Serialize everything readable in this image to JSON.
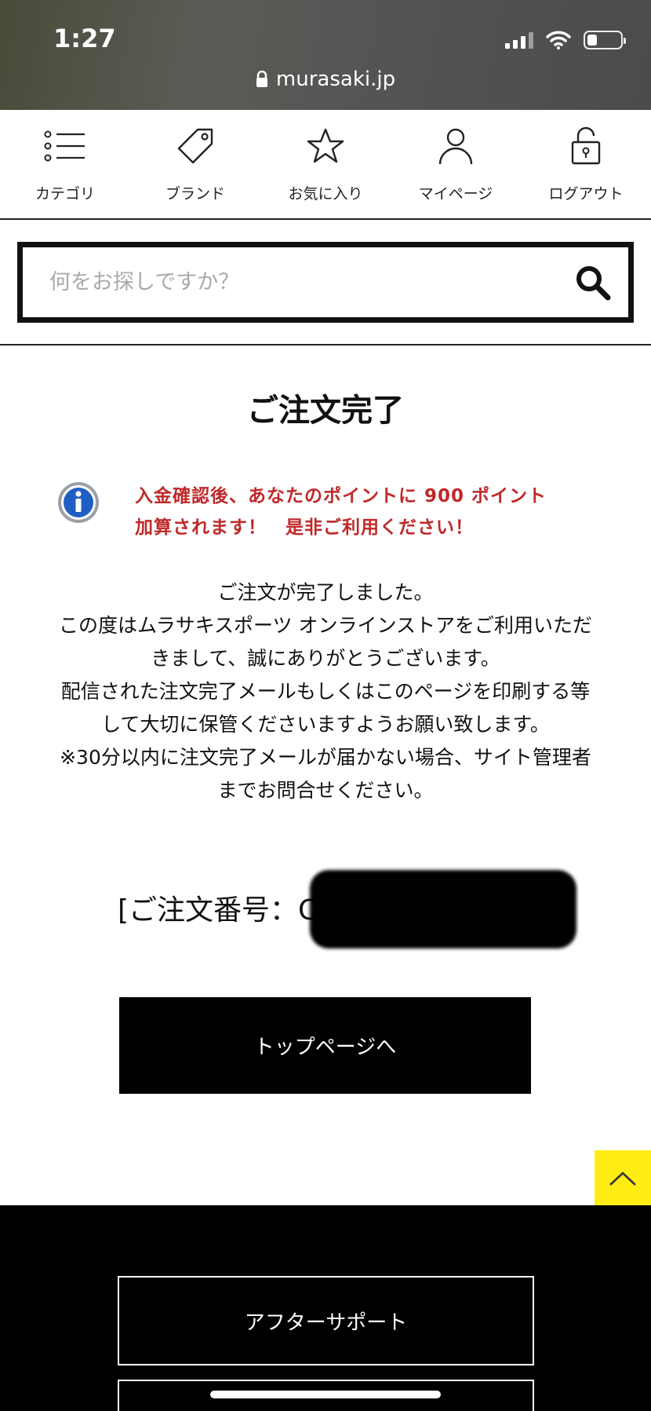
{
  "status_bar": {
    "time": "1:27"
  },
  "url_bar": {
    "domain": "murasaki.jp"
  },
  "nav": {
    "items": [
      {
        "label": "カテゴリ",
        "icon": "list-icon"
      },
      {
        "label": "ブランド",
        "icon": "tag-icon"
      },
      {
        "label": "お気に入り",
        "icon": "star-icon"
      },
      {
        "label": "マイページ",
        "icon": "user-icon"
      },
      {
        "label": "ログアウト",
        "icon": "unlock-icon"
      }
    ]
  },
  "search": {
    "placeholder": "何をお探しですか？",
    "value": ""
  },
  "page": {
    "title": "ご注文完了",
    "notice_line1": "入金確認後、あなたのポイントに 900 ポイント",
    "notice_line2": "加算されます！　是非ご利用ください！",
    "message_lines": [
      "ご注文が完了しました。",
      "この度はムラサキスポーツ オンラインストアをご利用いただ",
      "きまして、誠にありがとうございます。",
      "配信された注文完了メールもしくはこのページを印刷する等",
      "して大切に保管くださいますようお願い致します。",
      "※30分以内に注文完了メールが届かない場合、サイト管理者",
      "までお問合せください。"
    ],
    "order_number_label": "[ご注文番号：C",
    "top_page_button": "トップページへ"
  },
  "footer": {
    "after_support": "アフターサポート"
  },
  "colors": {
    "notice_red": "#c0292a",
    "scroll_top_yellow": "#ffed14"
  }
}
